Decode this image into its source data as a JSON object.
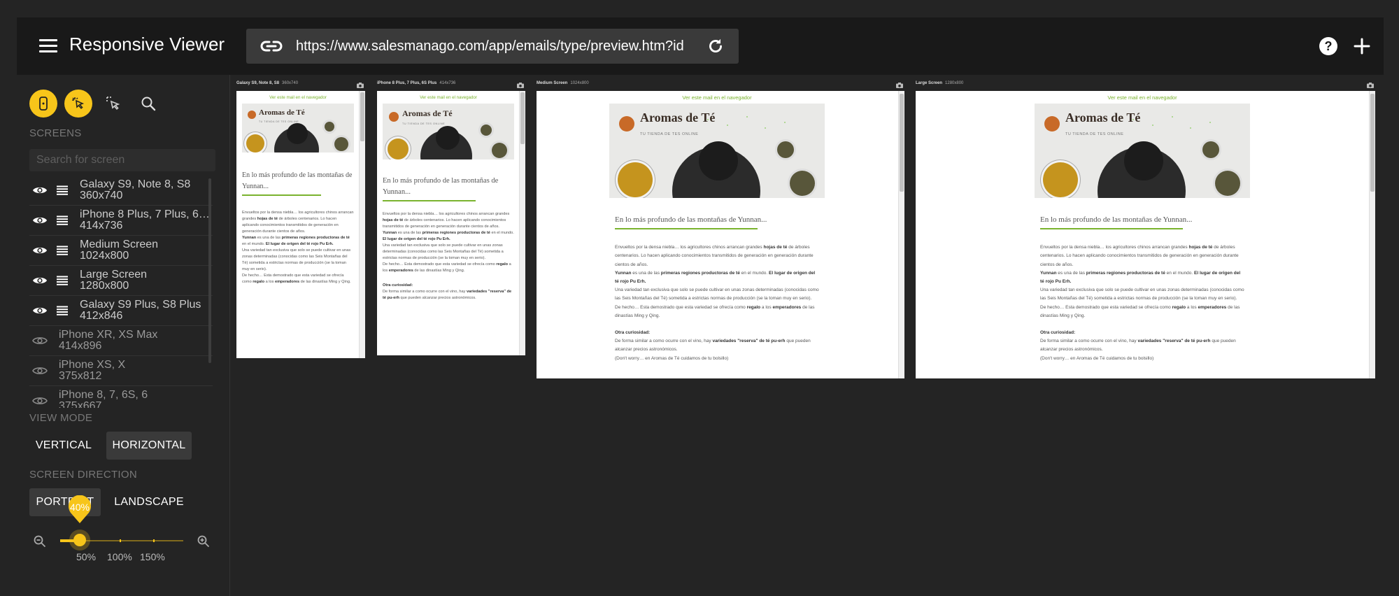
{
  "app": {
    "title": "Responsive Viewer",
    "url": "https://www.salesmanago.com/app/emails/type/preview.htm?id"
  },
  "sidebar": {
    "screens_label": "SCREENS",
    "search_placeholder": "Search for screen",
    "screens": [
      {
        "name": "Galaxy S9, Note 8, S8",
        "size": "360x740",
        "visible": true
      },
      {
        "name": "iPhone 8 Plus, 7 Plus, 6…",
        "size": "414x736",
        "visible": true
      },
      {
        "name": "Medium Screen",
        "size": "1024x800",
        "visible": true
      },
      {
        "name": "Large Screen",
        "size": "1280x800",
        "visible": true
      },
      {
        "name": "Galaxy S9 Plus, S8 Plus",
        "size": "412x846",
        "visible": true
      },
      {
        "name": "iPhone XR, XS Max",
        "size": "414x896",
        "visible": false
      },
      {
        "name": "iPhone XS, X",
        "size": "375x812",
        "visible": false
      },
      {
        "name": "iPhone 8, 7, 6S, 6",
        "size": "375x667",
        "visible": false
      }
    ],
    "view_mode_label": "VIEW MODE",
    "view_mode": {
      "vertical": "VERTICAL",
      "horizontal": "HORIZONTAL",
      "selected": "horizontal"
    },
    "direction_label": "SCREEN DIRECTION",
    "direction": {
      "portrait": "PORTRAIT",
      "landscape": "LANDSCAPE",
      "selected": "portrait"
    },
    "zoom": {
      "value": "40%",
      "fraction": 0.4,
      "ticks": [
        "50%",
        "100%",
        "150%"
      ]
    }
  },
  "email": {
    "view_in_browser": "Ver este mail en el navegador",
    "brand": "Aromas de Té",
    "tagline": "TU TIENDA DE TES ONLINE",
    "headline": "En lo más profundo de las montañas de Yunnan...",
    "p1a": "Envueltos por la densa niebla… los agricultores chinos arrancan grandes ",
    "p1b": "hojas de té",
    "p1c": " de árboles centenarios. Lo hacen aplicando conocimientos transmitidos de generación en generación durante cientos de años.",
    "p2a": "Yunnan",
    "p2b": " es una de las ",
    "p2c": "primeras regiones productoras de té",
    "p2d": " en el mundo. ",
    "p2e": "El lugar de origen del té rojo Pu Erh.",
    "p3": "Una variedad tan exclusiva que solo se puede cultivar en unas zonas determinadas (conocidas como las Seis Montañas del Té) sometida a estrictas normas de producción (se la toman muy en serio).",
    "p4a": "De hecho… Esta demostrado que esta variedad se ofrecía como ",
    "p4b": "regalo",
    "p4c": " a los ",
    "p4d": "emperadores",
    "p4e": " de las dinastías Ming y Qing.",
    "curiosity": "Otra curiosidad:",
    "p5a": "De forma similar a como ocurre con el vino, hay ",
    "p5b": "variedades \"reserva\" de té pu-erh",
    "p5c": " que pueden alcanzar precios astronómicos.",
    "p6": "(Don't worry… en Aromas de Té cuidamos de tu bolsillo)"
  },
  "devices": [
    {
      "name": "Galaxy S9, Note 8, S8",
      "size": "360x740"
    },
    {
      "name": "iPhone 8 Plus, 7 Plus, 6S Plus",
      "size": "414x736"
    },
    {
      "name": "Medium Screen",
      "size": "1024x800"
    },
    {
      "name": "Large Screen",
      "size": "1280x800"
    }
  ],
  "colors": {
    "accent": "#f7c51a",
    "background": "#242424",
    "topbar": "#191919",
    "email_green": "#7ab32e"
  }
}
